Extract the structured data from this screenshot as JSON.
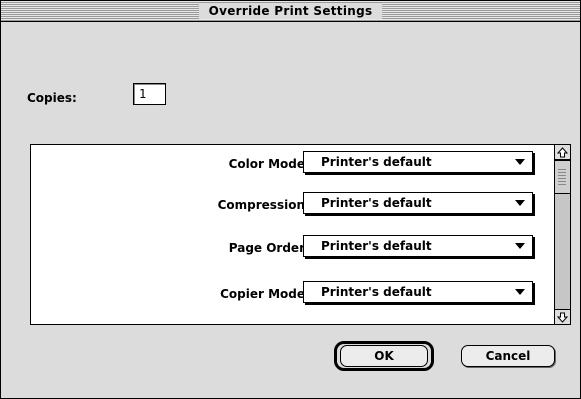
{
  "window": {
    "title": "Override Print Settings"
  },
  "copies": {
    "label": "Copies:",
    "value": "1"
  },
  "options": [
    {
      "label": "Color Mode",
      "value": "Printer's default"
    },
    {
      "label": "Compression",
      "value": "Printer's default"
    },
    {
      "label": "Page Order",
      "value": "Printer's default"
    },
    {
      "label": "Copier Mode",
      "value": "Printer's default"
    }
  ],
  "buttons": {
    "ok_label": "OK",
    "cancel_label": "Cancel"
  },
  "icons": {
    "scroll_up": "scroll-up-arrow-icon",
    "scroll_down": "scroll-down-arrow-icon",
    "popup_arrow": "dropdown-arrow-icon"
  }
}
